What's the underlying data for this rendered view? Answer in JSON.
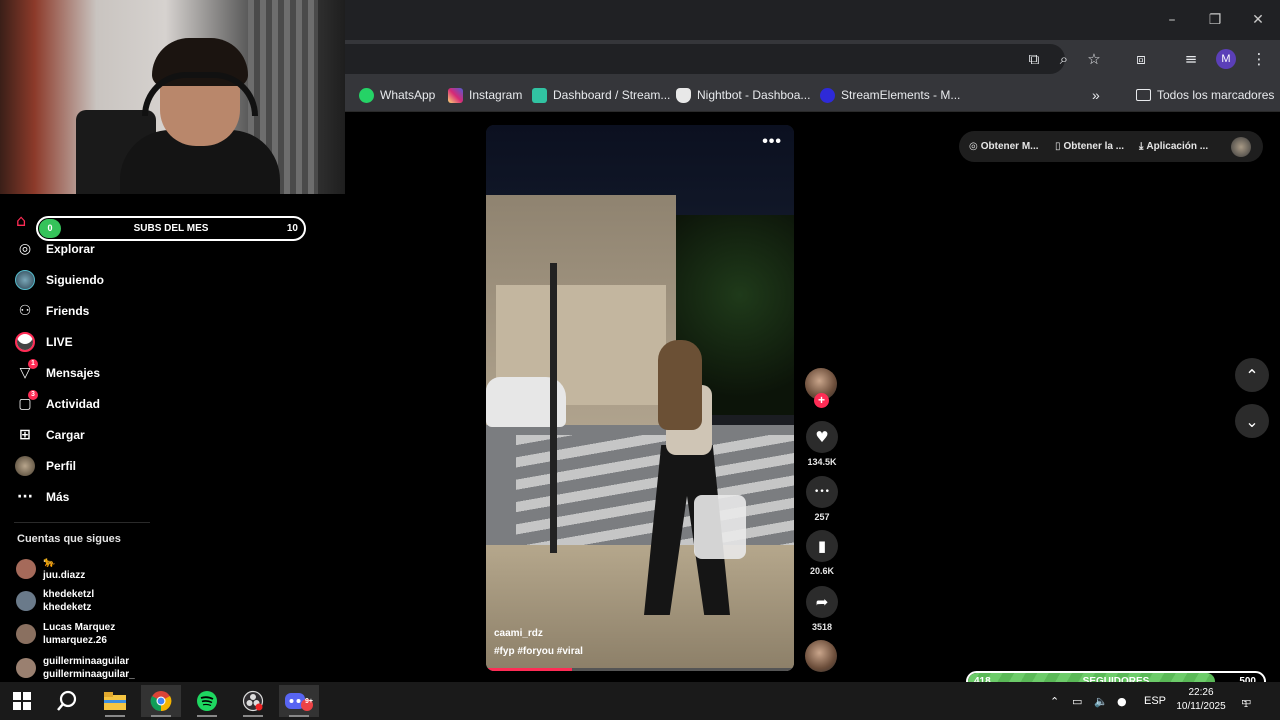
{
  "window_controls": {
    "minimize": "–",
    "restore": "❐",
    "close": "✕"
  },
  "toolbar_icons": [
    "cast-icon",
    "zoom-icon",
    "star-icon",
    "extensions-icon",
    "media-icon",
    "profile-avatar",
    "menu-icon"
  ],
  "profile_initial": "M",
  "bookmarks": [
    {
      "label": "WhatsApp",
      "icon": "whatsapp-icon",
      "color": "#25d366"
    },
    {
      "label": "Instagram",
      "icon": "instagram-icon",
      "color": "#d62976"
    },
    {
      "label": "Dashboard / Stream...",
      "icon": "streamlabs-icon",
      "color": "#31c3a2"
    },
    {
      "label": "Nightbot - Dashboa...",
      "icon": "nightbot-icon",
      "color": "#ffffff"
    },
    {
      "label": "StreamElements - M...",
      "icon": "streamelements-icon",
      "color": "#2e2ad8"
    }
  ],
  "bookmarks_overflow": "»",
  "all_bookmarks_label": "Todos los marcadores",
  "subs_bar": {
    "current": "0",
    "title": "SUBS DEL MES",
    "goal": "10",
    "progress_fraction": 0
  },
  "nav": [
    {
      "label": "Explorar",
      "icon": "compass-icon",
      "badge": ""
    },
    {
      "label": "Siguiendo",
      "icon": "avatar-icon",
      "badge": ""
    },
    {
      "label": "Friends",
      "icon": "friends-icon",
      "badge": ""
    },
    {
      "label": "LIVE",
      "icon": "live-icon",
      "badge": ""
    },
    {
      "label": "Mensajes",
      "icon": "send-icon",
      "badge": "1"
    },
    {
      "label": "Actividad",
      "icon": "activity-icon",
      "badge": "3"
    },
    {
      "label": "Cargar",
      "icon": "upload-icon",
      "badge": ""
    },
    {
      "label": "Perfil",
      "icon": "profile-icon",
      "badge": ""
    },
    {
      "label": "Más",
      "icon": "more-icon",
      "badge": ""
    }
  ],
  "following_title": "Cuentas que sigues",
  "following": [
    {
      "name": "🐆",
      "handle": "juu.diazz",
      "color": "#a56a5a"
    },
    {
      "name": "khedeketzl",
      "handle": "khedeketz",
      "color": "#6a7a8a"
    },
    {
      "name": "Lucas Marquez",
      "handle": "lumarquez.26",
      "color": "#8a7060"
    },
    {
      "name": "guillerminaaguilar",
      "handle": "guillerminaaguilar_",
      "color": "#9a8070"
    }
  ],
  "video": {
    "more": "•••",
    "author": "caami_rdz",
    "tags": "#fyp  #foryou  #viral",
    "progress_fraction": 0.28
  },
  "actions": [
    {
      "icon": "heart-icon",
      "glyph": "♥",
      "count": "134.5K"
    },
    {
      "icon": "comment-icon",
      "glyph": "•••",
      "count": "257"
    },
    {
      "icon": "bookmark-icon",
      "glyph": "▮",
      "count": "20.6K"
    },
    {
      "icon": "share-icon",
      "glyph": "➦",
      "count": "3518"
    }
  ],
  "follow_plus": "+",
  "topright": [
    {
      "label": "Obtener M...",
      "icon": "coin-icon",
      "glyph": "◎"
    },
    {
      "label": "Obtener la ...",
      "icon": "phone-icon",
      "glyph": "▯"
    },
    {
      "label": "Aplicación ...",
      "icon": "download-icon",
      "glyph": "⤓"
    }
  ],
  "arrows": {
    "up": "⌃",
    "down": "⌄"
  },
  "followers_bar": {
    "current": "418",
    "title": "SEGUIDORES",
    "goal": "500",
    "progress_fraction": 0.836
  },
  "taskbar_apps": [
    "windows-icon",
    "search-icon",
    "file-explorer-icon",
    "chrome-icon",
    "spotify-icon",
    "obs-icon",
    "discord-icon"
  ],
  "discord_badge": "9+",
  "tray": {
    "lang": "ESP",
    "time": "22:26",
    "date": "10/11/2025",
    "notifications": "1"
  }
}
